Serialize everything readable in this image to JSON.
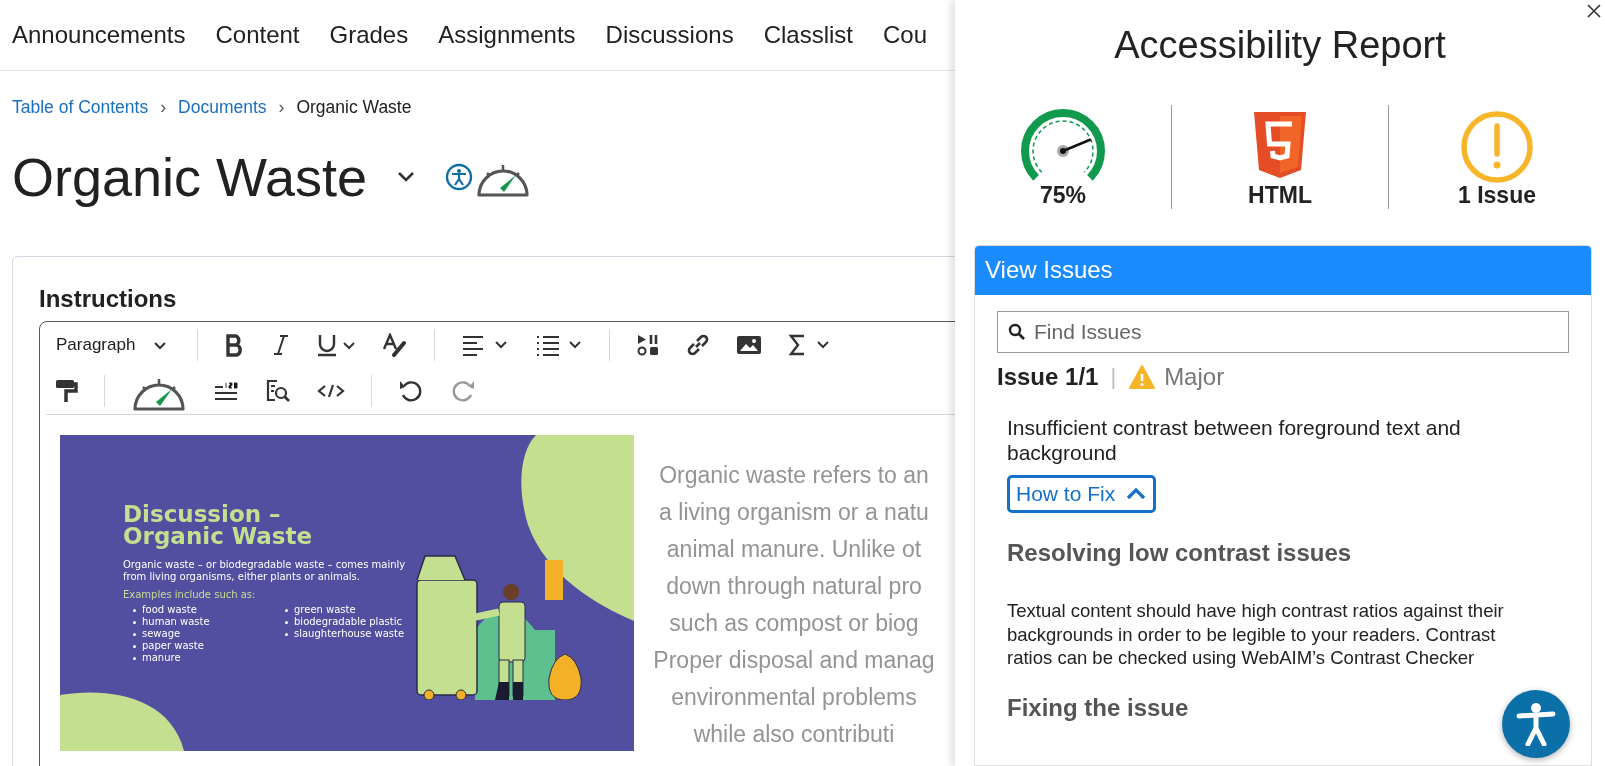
{
  "nav": {
    "items": [
      {
        "label": "Announcements"
      },
      {
        "label": "Content"
      },
      {
        "label": "Grades"
      },
      {
        "label": "Assignments"
      },
      {
        "label": "Discussions"
      },
      {
        "label": "Classlist"
      },
      {
        "label": "Cou"
      }
    ]
  },
  "breadcrumb": [
    {
      "label": "Table of Contents",
      "kind": "link"
    },
    {
      "label": "›",
      "kind": "separator"
    },
    {
      "label": "Documents",
      "kind": "link"
    },
    {
      "label": "›",
      "kind": "separator"
    },
    {
      "label": "Organic Waste",
      "kind": "current"
    }
  ],
  "page": {
    "title": "Organic Waste"
  },
  "editor": {
    "label": "Instructions",
    "format": "Paragraph",
    "slide": {
      "title": "Discussion – Organic Waste",
      "intro": "Organic waste – or biodegradable waste – comes mainly from living organisms, either plants or animals.",
      "examples_label": "Examples include such as:",
      "list_1": [
        "food waste",
        "human waste",
        "sewage",
        "paper waste",
        "manure"
      ],
      "list_2": [
        "green waste",
        "biodegradable plastic",
        "slaughterhouse waste"
      ]
    },
    "body_lines": [
      "Organic waste refers to an",
      "a living organism or a natu",
      "animal manure. Unlike ot",
      "down through natural pro",
      "such as compost or biog",
      "Proper disposal and manag",
      "environmental problems",
      "while also contributi"
    ]
  },
  "report": {
    "title": "Accessibility Report",
    "score": {
      "label": "75%",
      "level": 0.75
    },
    "format": "HTML",
    "issues_count": "1 Issue",
    "panel": {
      "header": "View Issues",
      "search": {
        "placeholder": "Find Issues"
      },
      "issue": {
        "position": "Issue 1/1",
        "separator": "|",
        "severity": "Major",
        "description": "Insufficient contrast between foreground text and background",
        "how_to_fix": {
          "label": "How to Fix",
          "expanded": true
        },
        "heading": "Resolving low contrast issues",
        "text": "Textual content should have high contrast ratios against their backgrounds in order to be legible to your readers. Contrast ratios can be checked using WebAIM’s Contrast Checker",
        "subheading": "Fixing the issue"
      }
    }
  }
}
